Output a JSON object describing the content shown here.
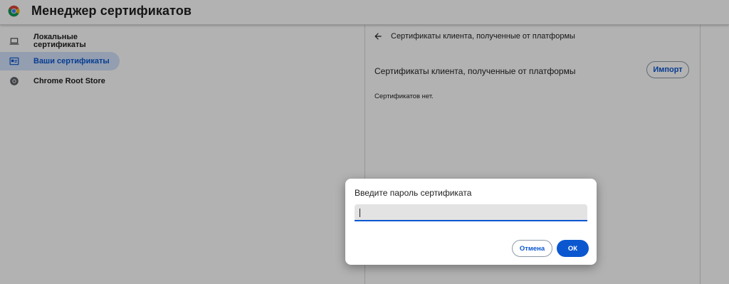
{
  "app": {
    "title": "Менеджер сертификатов",
    "logo_icon": "chrome-logo-icon"
  },
  "sidebar": {
    "items": [
      {
        "label": "Локальные сертификаты",
        "icon": "laptop-icon",
        "active": false
      },
      {
        "label": "Ваши сертификаты",
        "icon": "id-card-icon",
        "active": true
      },
      {
        "label": "Chrome Root Store",
        "icon": "chrome-icon",
        "active": false
      }
    ]
  },
  "main": {
    "back_icon": "arrow-back-icon",
    "heading": "Сертификаты клиента, полученные от платформы",
    "section_title": "Сертификаты клиента, полученные от платформы",
    "import_label": "Импорт",
    "empty_text": "Сертификатов нет."
  },
  "dialog": {
    "title": "Введите пароль сертификата",
    "password_value": "",
    "cancel_label": "Отмена",
    "ok_label": "ОК"
  },
  "colors": {
    "accent": "#0b57d0",
    "active_nav_bg": "#d3e3fd",
    "overlay": "rgba(0,0,0,0.30)"
  }
}
